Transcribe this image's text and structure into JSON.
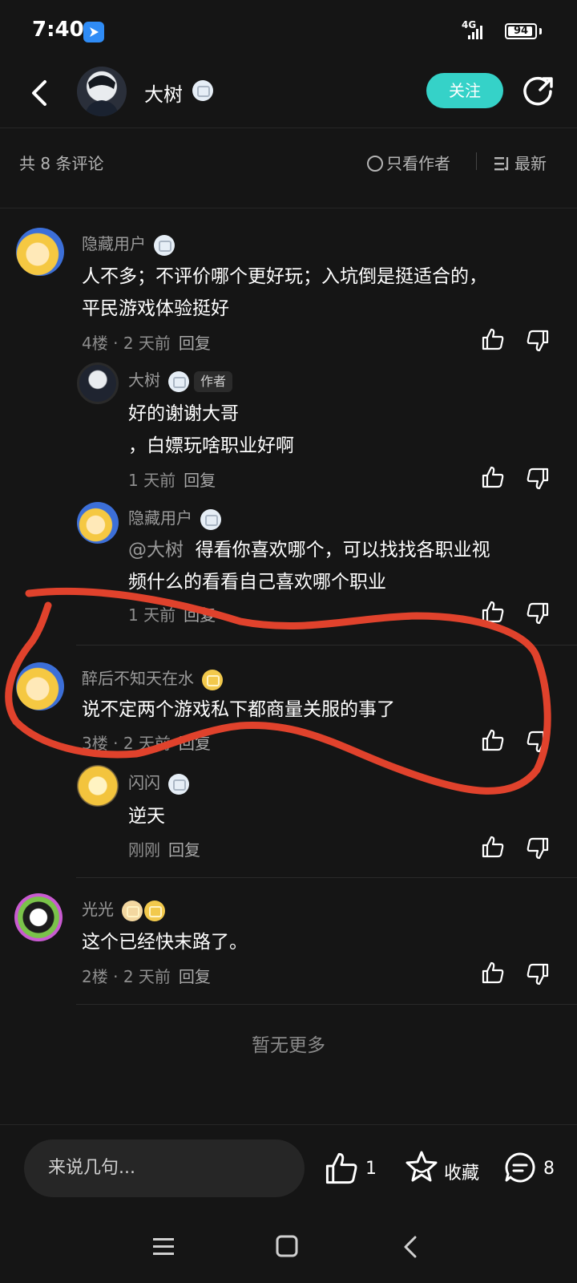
{
  "status_bar": {
    "time": "7:40",
    "network": "4G",
    "battery": "94",
    "battery_level": 0.94
  },
  "header": {
    "user_name": "大树",
    "follow_label": "关注"
  },
  "filter_bar": {
    "count_text": "共 8 条评论",
    "author_only_label": "只看作者",
    "sort_label": "最新"
  },
  "comments": [
    {
      "name": "隐藏用户",
      "lines": [
        "人不多；不评价哪个更好玩；入坑倒是挺适合的，",
        "平民游戏体验挺好"
      ],
      "floor": "4楼",
      "time": "2 天前",
      "reply_label": "回复",
      "replies": [
        {
          "name": "大树",
          "tag": "作者",
          "lines": [
            "好的谢谢大哥",
            "，白嫖玩啥职业好啊"
          ],
          "time": "1 天前",
          "reply_label": "回复"
        },
        {
          "name": "隐藏用户",
          "mention": "@大树",
          "lines": [
            "得看你喜欢哪个，可以找找各职业视",
            "频什么的看看自己喜欢哪个职业"
          ],
          "time": "1 天前",
          "reply_label": "回复"
        }
      ]
    },
    {
      "name": "醉后不知天在水",
      "lines": [
        "说不定两个游戏私下都商量关服的事了"
      ],
      "floor": "3楼",
      "time": "2 天前",
      "reply_label": "回复",
      "replies": [
        {
          "name": "闪闪",
          "lines": [
            "逆天"
          ],
          "time": "刚刚",
          "reply_label": "回复"
        }
      ]
    },
    {
      "name": "光光",
      "lines": [
        "这个已经快末路了。"
      ],
      "floor": "2楼",
      "time": "2 天前",
      "reply_label": "回复"
    }
  ],
  "no_more_text": "暂无更多",
  "bottom_bar": {
    "input_placeholder": "来说几句...",
    "like_count": "1",
    "collect_label": "收藏",
    "comment_count": "8"
  },
  "colors": {
    "accent": "#35d2c8",
    "background": "#151515",
    "annotation": "#e0422c"
  }
}
